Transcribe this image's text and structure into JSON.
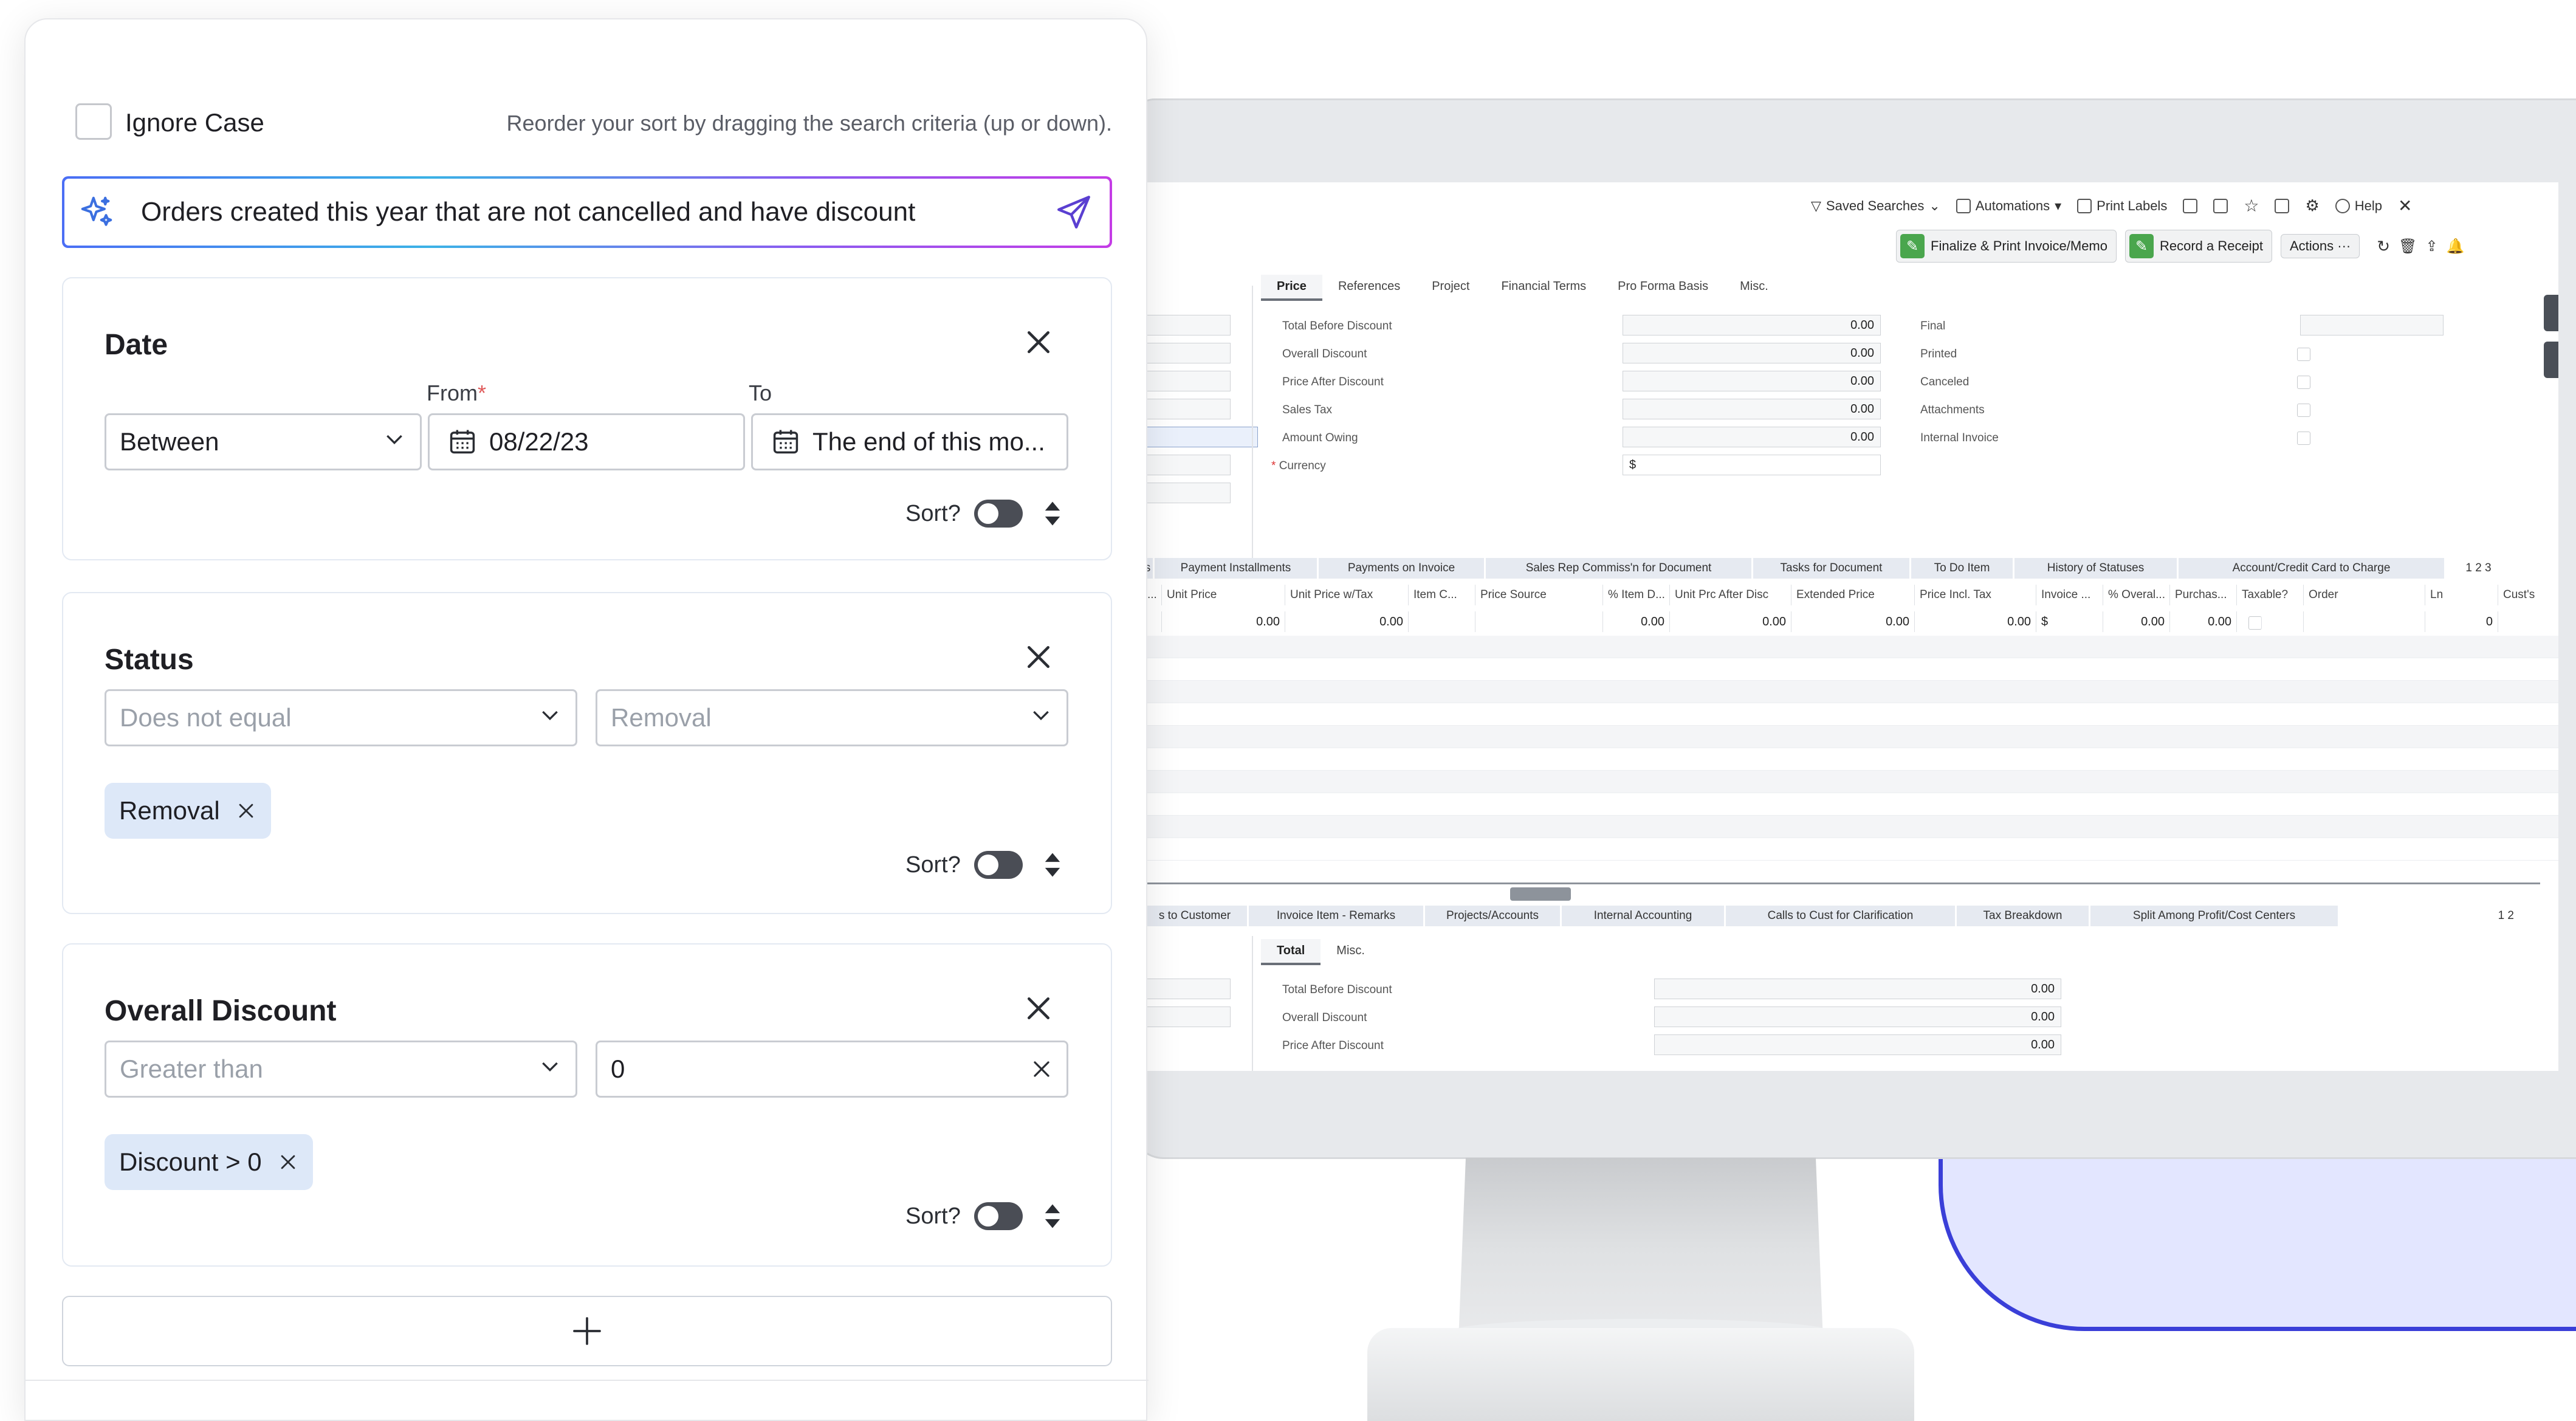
{
  "background": {
    "toolbar": {
      "saved_searches": "Saved Searches",
      "automations": "Automations",
      "print_labels": "Print Labels",
      "help": "Help",
      "finalize_print": "Finalize & Print Invoice/Memo",
      "record_receipt": "Record a Receipt",
      "actions": "Actions ···"
    },
    "top_tabs": [
      "Price",
      "References",
      "Project",
      "Financial Terms",
      "Pro Forma Basis",
      "Misc."
    ],
    "price_fields": [
      {
        "label": "Total Before Discount",
        "value": "0.00"
      },
      {
        "label": "Overall Discount",
        "value": "0.00"
      },
      {
        "label": "Price After Discount",
        "value": "0.00"
      },
      {
        "label": "Sales Tax",
        "value": "0.00"
      },
      {
        "label": "Amount Owing",
        "value": "0.00"
      },
      {
        "label": "Currency",
        "value": "$"
      }
    ],
    "flag_fields": [
      "Final",
      "Printed",
      "Canceled",
      "Attachments",
      "Internal Invoice"
    ],
    "grid_tabs": [
      "s",
      "Payment Installments",
      "Payments on Invoice",
      "Sales Rep Commiss'n for Document",
      "Tasks for Document",
      "To Do Item",
      "History of Statuses",
      "Account/Credit Card to Charge",
      "1 2 3"
    ],
    "grid_columns": [
      "...",
      "Unit Price",
      "Unit Price w/Tax",
      "Item C...",
      "Price Source",
      "% Item D...",
      "Unit Prc After Disc",
      "Extended Price",
      "Price Incl. Tax",
      "Invoice ...",
      "% Overal...",
      "Purchas...",
      "Taxable?",
      "Order",
      "Ln",
      "Cust's"
    ],
    "grid_row": [
      "",
      "0.00",
      "0.00",
      "",
      "",
      "0.00",
      "0.00",
      "0.00",
      "0.00",
      "$",
      "0.00",
      "0.00",
      "",
      "",
      "0",
      ""
    ],
    "bottom_grid_tabs": [
      "s to Customer",
      "Invoice Item - Remarks",
      "Projects/Accounts",
      "Internal Accounting",
      "Calls to Cust for Clarification",
      "Tax Breakdown",
      "Split Among Profit/Cost Centers",
      "1 2"
    ],
    "bottom_tabs": [
      "Total",
      "Misc."
    ],
    "bottom_fields": [
      {
        "label": "Total Before Discount",
        "value": "0.00"
      },
      {
        "label": "Overall Discount",
        "value": "0.00"
      },
      {
        "label": "Price After Discount",
        "value": "0.00"
      }
    ]
  },
  "panel": {
    "ignore_case_label": "Ignore Case",
    "reorder_hint": "Reorder your sort by dragging the search criteria (up or down).",
    "ai_prompt": "Orders created this year that are not cancelled and have discount",
    "date": {
      "title": "Date",
      "operator": "Between",
      "from_label": "From",
      "required_mark": "*",
      "to_label": "To",
      "from_value": "08/22/23",
      "to_value": "The end of this mo...",
      "sort_label": "Sort?"
    },
    "status": {
      "title": "Status",
      "operator": "Does not equal",
      "value_placeholder": "Removal",
      "chip": "Removal",
      "sort_label": "Sort?"
    },
    "discount": {
      "title": "Overall Discount",
      "operator": "Greater than",
      "value": "0",
      "chip": "Discount > 0",
      "sort_label": "Sort?"
    }
  },
  "colors": {
    "accent_gradient_start": "#4b6ef5",
    "accent_gradient_end": "#c43ce6",
    "chip_bg": "#dde8f8",
    "toggle_off": "#4a4d55",
    "decor_blue": "#3a3fd8"
  },
  "icons": [
    "sparkle-icon",
    "send-icon",
    "close-icon",
    "chevron-down-icon",
    "calendar-icon",
    "sort-arrows-icon",
    "plus-icon"
  ]
}
